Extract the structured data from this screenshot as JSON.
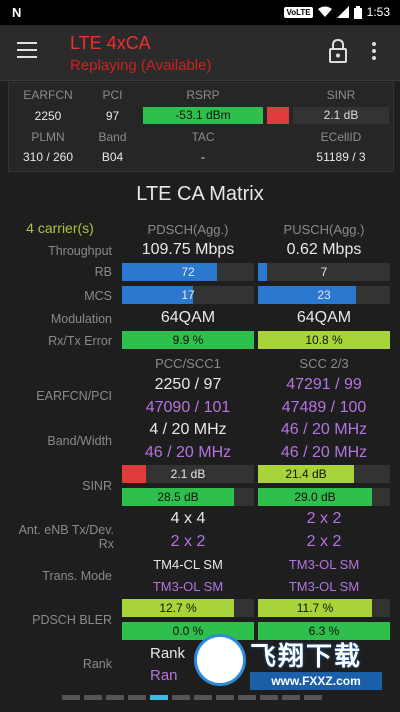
{
  "status_bar": {
    "left_icon": "N",
    "volte": "VoLTE",
    "time": "1:53"
  },
  "toolbar": {
    "title": "LTE 4xCA",
    "subtitle": "Replaying (Available)"
  },
  "info": {
    "labels": [
      "EARFCN",
      "PCI",
      "RSRP",
      "SINR",
      "PLMN",
      "Band",
      "TAC",
      "ECellID"
    ],
    "earfcn": "2250",
    "pci": "97",
    "rsrp": "-53.1 dBm",
    "sinr": "2.1 dB",
    "plmn": "310 / 260",
    "band": "B04",
    "tac": "-",
    "ecellid": "51189 / 3"
  },
  "matrix": {
    "title": "LTE CA Matrix",
    "carriers": "4 carrier(s)",
    "col_headers": [
      "PDSCH(Agg.)",
      "PUSCH(Agg.)"
    ],
    "throughput": {
      "label": "Throughput",
      "pdsch": "109.75 Mbps",
      "pusch": "0.62 Mbps"
    },
    "rb": {
      "label": "RB",
      "pdsch": "72",
      "pusch": "7",
      "pdsch_fill": 0.72,
      "pusch_fill": 0.07
    },
    "mcs": {
      "label": "MCS",
      "pdsch": "17",
      "pusch": "23",
      "pdsch_fill": 0.54,
      "pusch_fill": 0.74
    },
    "modulation": {
      "label": "Modulation",
      "pdsch": "64QAM",
      "pusch": "64QAM"
    },
    "error": {
      "label": "Rx/Tx Error",
      "pdsch": "9.9 %",
      "pusch": "10.8 %"
    },
    "cc_headers": [
      "PCC/SCC1",
      "SCC 2/3"
    ],
    "earfcn_pci": {
      "label": "EARFCN/PCI",
      "pcc": "2250 / 97",
      "scc1": "47090 / 101",
      "scc2": "47291 / 99",
      "scc3": "47489 / 100"
    },
    "band_width": {
      "label": "Band/Width",
      "pcc": "4 / 20 MHz",
      "scc1": "46 / 20 MHz",
      "scc2": "46 / 20 MHz",
      "scc3": "46 / 20 MHz"
    },
    "sinr": {
      "label": "SINR",
      "pcc": "2.1 dB",
      "scc1": "28.5 dB",
      "scc2": "21.4 dB",
      "scc3": "29.0 dB"
    },
    "ant": {
      "label": "Ant. eNB Tx/Dev. Rx",
      "pcc": "4 x 4",
      "scc1": "2 x 2",
      "scc2": "2 x 2",
      "scc3": "2 x 2"
    },
    "trans_mode": {
      "label": "Trans. Mode",
      "pcc": "TM4-CL SM",
      "scc1": "TM3-OL SM",
      "scc2": "TM3-OL SM",
      "scc3": "TM3-OL SM"
    },
    "bler": {
      "label": "PDSCH BLER",
      "pcc": "12.7 %",
      "scc1": "0.0 %",
      "scc2": "11.7 %",
      "scc3": "6.3 %"
    },
    "rank": {
      "label": "Rank",
      "pcc": "Rank",
      "scc1": "Ran"
    }
  },
  "watermark": {
    "text": "飞翔下载",
    "url": "www.FXXZ.com"
  },
  "colors": {
    "accent_red": "#f03030",
    "green": "#2fbf4c",
    "blue": "#2a78d0",
    "purple": "#b574e0",
    "lime": "#a8d43a"
  }
}
